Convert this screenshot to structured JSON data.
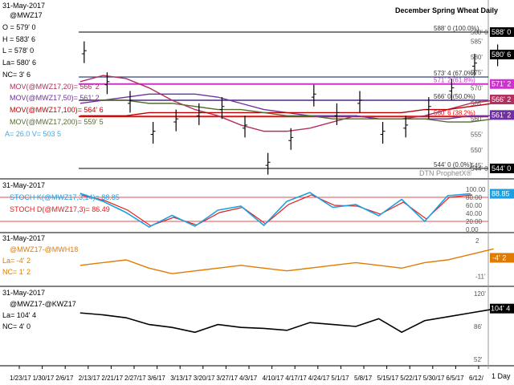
{
  "header": {
    "date": "31-May-2017",
    "symbol": "@MWZ17",
    "title": "December Spring Wheat Daily",
    "ohlc": [
      "O = 579' 0",
      "H = 583' 6",
      "L = 578' 0",
      "La= 580' 6",
      "NC= 3' 6"
    ]
  },
  "main": {
    "ma_labels": [
      {
        "text": "MOV(@MWZ17,20)= 566' 2",
        "color": "#b03060"
      },
      {
        "text": "MOV(@MWZ17,50)= 561' 2",
        "color": "#7030a0"
      },
      {
        "text": "MOV(@MWZ17,100)= 564' 6",
        "color": "#c00000"
      },
      {
        "text": "MOV(@MWZ17,200)= 559' 5",
        "color": "#556b2f"
      }
    ],
    "volume_label": "A= 26.0  V= 503  5",
    "fib_labels": [
      {
        "text": "588' 0 (100.0%)",
        "value": 588
      },
      {
        "text": "573' 4 (67.0%)",
        "value": 573.5
      },
      {
        "text": "571' 2 (61.8%)",
        "value": 571.25
      },
      {
        "text": "566' 0 (50.0%)",
        "value": 566
      },
      {
        "text": "560' 6 (38.2%)",
        "value": 560.75
      },
      {
        "text": "544' 0 (0.0%)",
        "value": 544
      }
    ],
    "y_ticks": [
      "588' 0",
      "585'",
      "580'",
      "575'",
      "570'",
      "565'",
      "560'",
      "555'",
      "550'",
      "545'",
      "544' 0"
    ],
    "right_tags": [
      {
        "text": "588' 0",
        "bg": "#000000",
        "fg": "#ffffff",
        "value": 588
      },
      {
        "text": "580' 6",
        "bg": "#000000",
        "fg": "#ffffff",
        "value": 580.75
      },
      {
        "text": "571' 2",
        "bg": "#cc33cc",
        "fg": "#ffffff",
        "value": 571.25
      },
      {
        "text": "566' 2",
        "bg": "#b03060",
        "fg": "#ffffff",
        "value": 566.25
      },
      {
        "text": "561' 2",
        "bg": "#7030a0",
        "fg": "#ffffff",
        "value": 561.25
      },
      {
        "text": "544' 0",
        "bg": "#000000",
        "fg": "#ffffff",
        "value": 544
      }
    ],
    "watermark": "DTN ProphetX®"
  },
  "stoch": {
    "date": "31-May-2017",
    "k_label": "STOCH K(@MWZ17,3,14)= 88.85",
    "d_label": "STOCH D(@MWZ17,3)= 86.49",
    "y_ticks": [
      "100.00",
      "80.00",
      "60.00",
      "40.00",
      "20.00",
      "0.00"
    ],
    "tag": "88.85"
  },
  "spread": {
    "date": "31-May-2017",
    "symbol": "@MWZ17-@MWH18",
    "la": "La= -4' 2",
    "nc": "NC= 1' 2",
    "y_ticks": [
      "2",
      "-11'"
    ],
    "tag": "-4' 2"
  },
  "inter": {
    "date": "31-May-2017",
    "symbol": "@MWZ17-@KWZ17",
    "la": "La= 104' 4",
    "nc": "NC= 4' 0",
    "y_ticks": [
      "120'",
      "104' 4",
      "86'",
      "52'"
    ],
    "tag": "104' 4"
  },
  "x_axis": {
    "labels": [
      "1/23/17",
      "1/30/17",
      "2/6/17",
      "2/13/17",
      "2/21/17",
      "2/27/17",
      "3/6/17",
      "3/13/17",
      "3/20/17",
      "3/27/17",
      "4/3/17",
      "4/10/17",
      "4/17/17",
      "4/24/17",
      "5/1/17",
      "5/8/17",
      "5/15/17",
      "5/22/17",
      "5/30/17",
      "6/5/17",
      "6/12/"
    ],
    "period": "1 Day"
  },
  "chart_data": {
    "type": "line",
    "title": "December Spring Wheat Daily",
    "x": [
      "1/23/17",
      "1/30/17",
      "2/6/17",
      "2/13/17",
      "2/21/17",
      "2/27/17",
      "3/6/17",
      "3/13/17",
      "3/20/17",
      "3/27/17",
      "4/3/17",
      "4/10/17",
      "4/17/17",
      "4/24/17",
      "5/1/17",
      "5/8/17",
      "5/15/17",
      "5/22/17",
      "5/30/17"
    ],
    "ylim": [
      543,
      589
    ],
    "series": [
      {
        "name": "@MWZ17",
        "values": [
          582,
          572,
          566,
          556,
          560,
          562,
          564,
          558,
          546,
          554,
          568,
          562,
          566,
          556,
          558,
          564,
          570,
          578,
          581
        ]
      },
      {
        "name": "MOV(@MWZ17,20)",
        "values": [
          572,
          574,
          573,
          570,
          566,
          563,
          561,
          558,
          556,
          556,
          557,
          559,
          561,
          560,
          560,
          561,
          563,
          565,
          566
        ]
      },
      {
        "name": "MOV(@MWZ17,50)",
        "values": [
          565,
          566,
          567,
          568,
          568,
          568,
          567,
          565,
          563,
          562,
          561,
          561,
          561,
          560,
          560,
          560,
          560,
          561,
          561
        ]
      },
      {
        "name": "MOV(@MWZ17,100)",
        "values": [
          561,
          561,
          561,
          562,
          562,
          562,
          562,
          562,
          562,
          562,
          562,
          562,
          562,
          562,
          562,
          563,
          563,
          564,
          565
        ]
      },
      {
        "name": "MOV(@MWZ17,200)",
        "values": [
          566,
          566,
          566,
          565,
          565,
          564,
          563,
          563,
          562,
          561,
          561,
          560,
          560,
          560,
          560,
          560,
          559,
          559,
          560
        ]
      },
      {
        "name": "STOCH K(@MWZ17,3,14)",
        "values": [
          90,
          70,
          42,
          6,
          35,
          8,
          48,
          58,
          10,
          70,
          92,
          55,
          62,
          34,
          75,
          20,
          84,
          89
        ]
      },
      {
        "name": "STOCH D(@MWZ17,3)",
        "values": [
          85,
          72,
          48,
          9,
          30,
          11,
          42,
          55,
          14,
          62,
          86,
          60,
          58,
          38,
          68,
          26,
          80,
          86
        ]
      },
      {
        "name": "@MWZ17-@MWH18",
        "values": [
          -7,
          -6,
          -5,
          -8,
          -10,
          -9,
          -8,
          -7,
          -8,
          -9,
          -8,
          -7,
          -6,
          -7,
          -8,
          -6,
          -5,
          -3,
          -1
        ]
      },
      {
        "name": "@MWZ17-@KWZ17",
        "values": [
          100,
          98,
          95,
          88,
          85,
          80,
          88,
          85,
          84,
          82,
          90,
          88,
          86,
          94,
          80,
          92,
          96,
          100,
          104
        ]
      }
    ]
  }
}
